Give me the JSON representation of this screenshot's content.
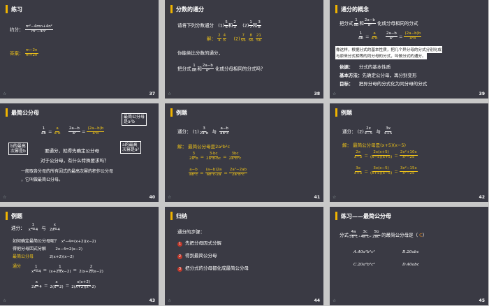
{
  "slides": [
    {
      "title": "练习",
      "number": "37",
      "line1_label": "约分：",
      "line1_num": "m²−4mn+4n²",
      "line1_den": "m²−4n²",
      "answer_label": "答案：",
      "answer_num": "m−2n",
      "answer_den": "m+2n"
    },
    {
      "title": "分数的通分",
      "number": "38",
      "prompt": "请将下列分数通分",
      "p1": "(1)",
      "p1a_n": "5",
      "p1a_d": "6",
      "p1_and": "和",
      "p1b_n": "2",
      "p1b_d": "3",
      "p2": "(2)",
      "p2a_n": "1",
      "p2a_d": "7",
      "p2b_n": "3",
      "p2b_d": "8",
      "sol": "解：",
      "s1a_n": "2",
      "s1a_d": "4",
      "s1b_n": "4",
      "s1b_d": "6",
      "s2a_n": "7",
      "s2a_d": "56",
      "s2b_n": "8",
      "s2b_d": "56",
      "s2c_n": "21",
      "s2c_d": "56",
      "q1": "你能类比分数的通分，",
      "q2_pre": "把分式",
      "q2_a_n": "1",
      "q2_a_d": "ab",
      "q2_and": "和",
      "q2_b_n": "2a−b",
      "q2_b_d": "a²",
      "q2_post": "化成分母相同的分式吗？"
    },
    {
      "title": "通分的概念",
      "number": "39",
      "l1_pre": "把分式",
      "l1_a_n": "1",
      "l1_a_d": "ab",
      "l1_and": "和",
      "l1_b_n": "2a−b",
      "l1_b_d": "a²",
      "l1_post": "化成分母相同的分式",
      "e1_n": "1",
      "e1_d": "ab",
      "e2_n": "a",
      "e2_d": "a²b",
      "e3_n": "2a−b",
      "e3_d": "a²",
      "e4_n": "(2a−b)b",
      "e4_d": "a²b",
      "para1": "像这样，根据分式的基本性质，把几个异分母的分式分别化成",
      "para2": "与原来分式相等的同分母的分式，叫做分式的通分。",
      "basis_label": "依据：",
      "basis_text": "分式的基本性质",
      "key_label": "基本方法：",
      "key_text": "先确定公分母，再分别变形",
      "goal_label": "目标：",
      "goal_text": "把异分母的分式化为同分母的分式"
    },
    {
      "title": "最简公分母",
      "number": "40",
      "f1_n": "1",
      "f1_d": "ab",
      "f2_n": "a",
      "f2_d": "a²b",
      "f3_n": "2a−b",
      "f3_d": "a²",
      "f4_n": "(2a−b)b",
      "f4_d": "a²b",
      "box_top": "最简公分母",
      "box_top2": "是a²b",
      "box_left1": "b的最高",
      "box_left2": "次幂是b",
      "box_right1": "a的最高",
      "box_right2": "次幂是a²",
      "q1": "要通分，就得先确定公分母",
      "q2": "对于公分母，有什么特殊要求吗？",
      "d1": "一般取各分母的所有因式的最高次幂的积作公分母",
      "d2": "，它叫做最简公分母。"
    },
    {
      "title": "例题",
      "number": "41",
      "task": "通分：",
      "p1": "(1)",
      "a_n": "3",
      "a_d": "2a²b",
      "and": "与",
      "b_n": "a−b",
      "b_d": "ab²c",
      "sol": "解：",
      "sol_text": "最简公分母是2a²b²c",
      "r1a_n": "3",
      "r1a_d": "2a²b",
      "r1b_n": "3·bc",
      "r1b_d": "2a²b·bc",
      "r1c_n": "3bc",
      "r1c_d": "2a²b²c",
      "r2a_n": "a−b",
      "r2a_d": "ab²c",
      "r2b_n": "(a−b)2a",
      "r2b_d": "ab²c·2a",
      "r2c_n": "2a²−2ab",
      "r2c_d": "2a²b²c"
    },
    {
      "title": "例题",
      "number": "42",
      "task": "通分：",
      "p2": "(2)",
      "a_n": "2x",
      "a_d": "x−5",
      "and": "与",
      "b_n": "3x",
      "b_d": "x+5",
      "sol": "解：",
      "sol_text": "最简公分母是(x+5)(x−5)",
      "r1a_n": "2x",
      "r1a_d": "x−5",
      "r1b_n": "2x(x+5)",
      "r1b_d": "(x−5)(x+5)",
      "r1c_n": "2x²+10x",
      "r1c_d": "x²−25",
      "r2a_n": "3x",
      "r2a_d": "x+5",
      "r2b_n": "3x(x−5)",
      "r2b_d": "(x+5)(x−5)",
      "r2c_n": "3x²−15x",
      "r2c_d": "x²−25"
    },
    {
      "title": "例题",
      "number": "43",
      "task": "通分：",
      "a_n": "1",
      "a_d": "x²−4",
      "and": "与",
      "b_n": "x",
      "b_d": "2x−4",
      "q": "如何确定最简公分母呢？",
      "q_eq": "x²−4=(x+2)(x−2)",
      "l2": "得把分母因式分解",
      "l2_eq": "2x−4=2(x−2)",
      "l3": "最简公分母",
      "l3_eq": "2(x+2)(x−2)",
      "l4": "通分",
      "c1_n": "1",
      "c1_d": "x²−4",
      "c2_n": "1",
      "c2_d": "(x+2)(x−2)",
      "c3_n": "2",
      "c3_d": "2(x+2)(x−2)",
      "c4_n": "x",
      "c4_d": "2x−4",
      "c5_n": "x",
      "c5_d": "2(x−2)",
      "c6_n": "x(x+2)",
      "c6_d": "2(x+2)(x−2)"
    },
    {
      "title": "归纳",
      "number": "44",
      "steps_title": "通分的步骤：",
      "steps": [
        "先把分母因式分解",
        "得到最简公分母",
        "把分式的分母都化成最简公分母"
      ]
    },
    {
      "title": "练习——最简公分母",
      "number": "45",
      "q_pre": "分式",
      "qa_n": "4a",
      "qa_d": "5b²c",
      "qb_n": "3c",
      "qb_d": "4a²b",
      "qc_n": "5b",
      "qc_d": "2ac²",
      "q_post": "的最简公分母是（",
      "q_ans": "C",
      "q_close": "）",
      "optA": "A.40a²b²c²",
      "optB": "B.20abc",
      "optC": "C.20a²b²c²",
      "optD": "D.40abc"
    }
  ],
  "star": "☆"
}
